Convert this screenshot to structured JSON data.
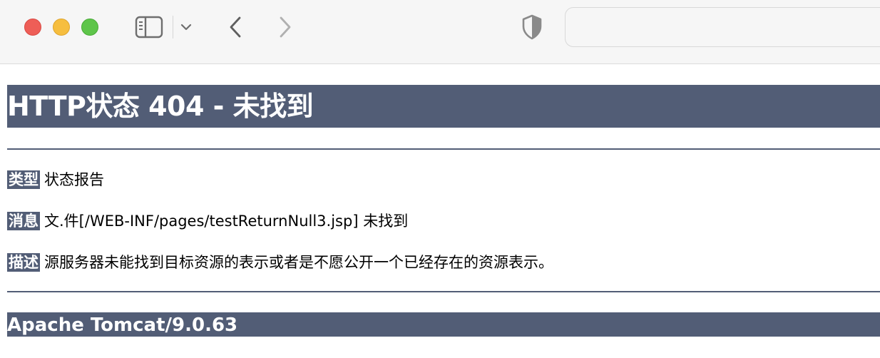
{
  "browser": {
    "address_value": "",
    "icons": {
      "sidebar": "sidebar-icon",
      "sidebar_menu": "chevron-down-icon",
      "back": "chevron-left-icon",
      "forward": "chevron-right-icon",
      "privacy": "shield-icon"
    },
    "colors": {
      "close": "#ee5e57",
      "minimize": "#f6be3f",
      "zoom": "#5ec54a"
    }
  },
  "page": {
    "title": "HTTP状态 404 - 未找到",
    "rows": [
      {
        "label": "类型",
        "text": "状态报告"
      },
      {
        "label": "消息",
        "text": "文.件[/WEB-INF/pages/testReturnNull3.jsp] 未找到"
      },
      {
        "label": "描述",
        "text": "源服务器未能找到目标资源的表示或者是不愿公开一个已经存在的资源表示。"
      }
    ],
    "footer": "Apache Tomcat/9.0.63",
    "accent_color": "#525d76"
  }
}
